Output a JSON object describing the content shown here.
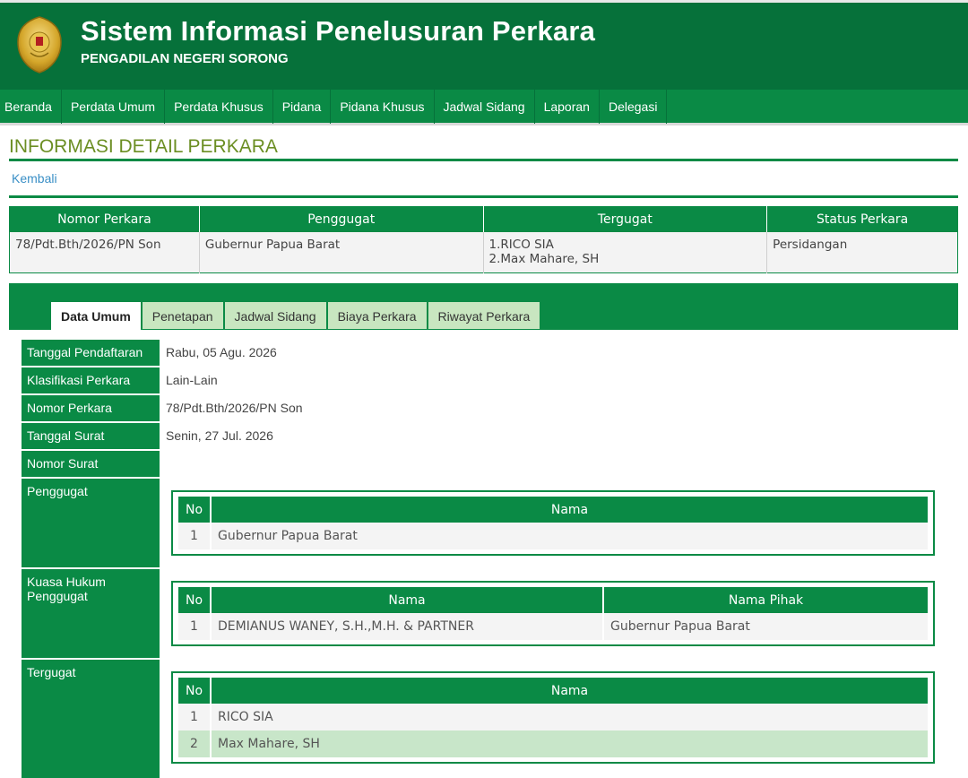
{
  "header": {
    "title": "Sistem Informasi Penelusuran Perkara",
    "subtitle": "PENGADILAN NEGERI SORONG",
    "logo_icon": "court-emblem-icon"
  },
  "nav": {
    "items": [
      "Beranda",
      "Perdata Umum",
      "Perdata Khusus",
      "Pidana",
      "Pidana Khusus",
      "Jadwal Sidang",
      "Laporan",
      "Delegasi"
    ]
  },
  "page": {
    "title": "INFORMASI DETAIL PERKARA",
    "back_label": "Kembali"
  },
  "summary": {
    "headers": [
      "Nomor Perkara",
      "Penggugat",
      "Tergugat",
      "Status Perkara"
    ],
    "nomor": "78/Pdt.Bth/2026/PN Son",
    "penggugat": "Gubernur Papua Barat",
    "tergugat_1": "1.RICO SIA",
    "tergugat_2": "2.Max Mahare, SH",
    "status": "Persidangan"
  },
  "tabs": [
    "Data Umum",
    "Penetapan",
    "Jadwal Sidang",
    "Biaya Perkara",
    "Riwayat Perkara"
  ],
  "data_umum": {
    "tanggal_pendaftaran": {
      "label": "Tanggal Pendaftaran",
      "value": "Rabu, 05 Agu. 2026"
    },
    "klasifikasi": {
      "label": "Klasifikasi Perkara",
      "value": "Lain-Lain"
    },
    "nomor_perkara": {
      "label": "Nomor Perkara",
      "value": "78/Pdt.Bth/2026/PN Son"
    },
    "tanggal_surat": {
      "label": "Tanggal Surat",
      "value": "Senin, 27 Jul. 2026"
    },
    "nomor_surat": {
      "label": "Nomor Surat",
      "value": ""
    },
    "penggugat": {
      "label": "Penggugat",
      "headers": [
        "No",
        "Nama"
      ],
      "rows": [
        {
          "no": "1",
          "nama": "Gubernur Papua Barat"
        }
      ]
    },
    "kuasa_hukum": {
      "label_1": "Kuasa Hukum",
      "label_2": "Penggugat",
      "headers": [
        "No",
        "Nama",
        "Nama Pihak"
      ],
      "rows": [
        {
          "no": "1",
          "nama": "DEMIANUS WANEY, S.H.,M.H. & PARTNER",
          "pihak": "Gubernur Papua Barat"
        }
      ]
    },
    "tergugat": {
      "label": "Tergugat",
      "headers": [
        "No",
        "Nama"
      ],
      "rows": [
        {
          "no": "1",
          "nama": "RICO SIA"
        },
        {
          "no": "2",
          "nama": "Max Mahare, SH"
        }
      ]
    }
  },
  "colors": {
    "header_green": "#06713a",
    "nav_green": "#0a8a45",
    "title_olive": "#6b8e23",
    "link_blue": "#3a8fc6",
    "tab_inactive": "#c8e6c0"
  }
}
